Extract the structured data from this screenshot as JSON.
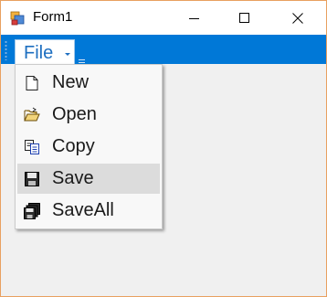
{
  "window": {
    "title": "Form1"
  },
  "menubar": {
    "file_label": "File"
  },
  "menu": {
    "items": [
      {
        "label": "New",
        "icon": "new-document-icon"
      },
      {
        "label": "Open",
        "icon": "open-folder-icon"
      },
      {
        "label": "Copy",
        "icon": "copy-icon"
      },
      {
        "label": "Save",
        "icon": "save-icon",
        "highlighted": true
      },
      {
        "label": "SaveAll",
        "icon": "save-all-icon"
      }
    ]
  },
  "colors": {
    "toolbar": "#0078d7",
    "window_border": "#e8a060",
    "highlight": "#dcdcdc"
  }
}
